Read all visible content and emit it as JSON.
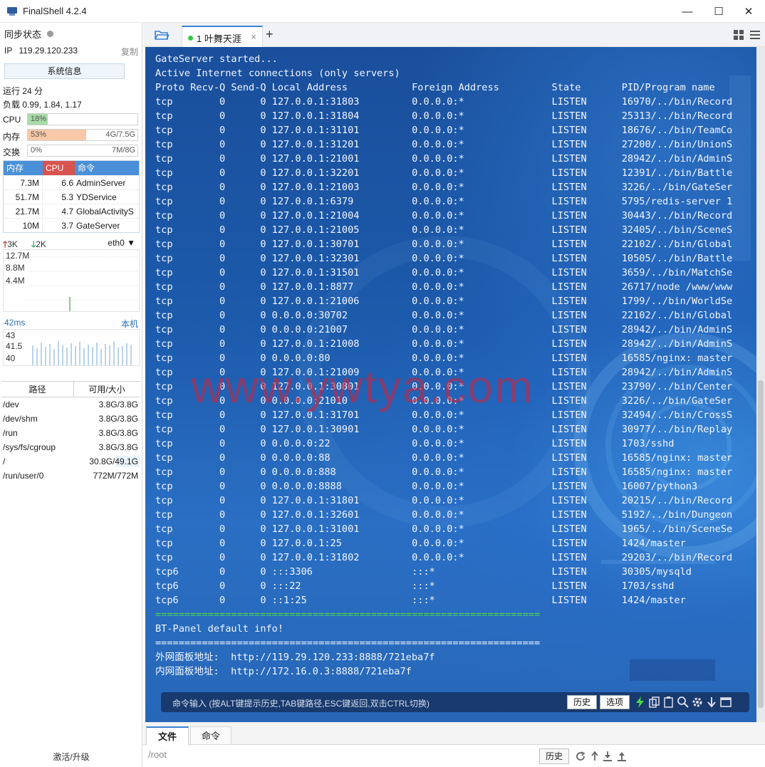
{
  "window": {
    "title": "FinalShell 4.2.4",
    "min": "—",
    "max": "☐",
    "close": "✕"
  },
  "sidebar": {
    "sync_label": "同步状态",
    "ip_label": "IP",
    "ip_value": "119.29.120.233",
    "copy_label": "复制",
    "sysinfo_button": "系统信息",
    "uptime": "运行 24 分",
    "load": "负载 0.99, 1.84, 1.17",
    "cpu": {
      "label": "CPU",
      "percent": "18%",
      "value": 0.18
    },
    "mem": {
      "label": "内存",
      "percent": "53%",
      "size": "4G/7.5G",
      "value": 0.53
    },
    "swap": {
      "label": "交换",
      "percent": "0%",
      "size": "7M/8G",
      "value": 0.0
    },
    "process_header": {
      "mem": "内存",
      "cpu": "CPU",
      "cmd": "命令"
    },
    "processes": [
      {
        "mem": "7.3M",
        "cpu": "6.6",
        "cmd": "AdminServer"
      },
      {
        "mem": "51.7M",
        "cpu": "5.3",
        "cmd": "YDService"
      },
      {
        "mem": "21.7M",
        "cpu": "4.7",
        "cmd": "GlobalActivityS"
      },
      {
        "mem": "10M",
        "cpu": "3.7",
        "cmd": "GateServer"
      }
    ],
    "net": {
      "up": "3K",
      "down": "2K",
      "interface": "eth0",
      "up_arrow": "🡑",
      "down_arrow": "🡓",
      "dropdown": "▼"
    },
    "net_scale": [
      "12.7M",
      "8.8M",
      "4.4M"
    ],
    "latency": {
      "ms": "42ms",
      "host": "本机"
    },
    "latency_scale": [
      "43",
      "41.5",
      "40"
    ],
    "disk_header": {
      "path": "路径",
      "size": "可用/大小"
    },
    "disks": [
      {
        "path": "/dev",
        "size": "3.8G/3.8G",
        "used": 0.0
      },
      {
        "path": "/dev/shm",
        "size": "3.8G/3.8G",
        "used": 0.0
      },
      {
        "path": "/run",
        "size": "3.8G/3.8G",
        "used": 0.0
      },
      {
        "path": "/sys/fs/cgroup",
        "size": "3.8G/3.8G",
        "used": 0.0
      },
      {
        "path": "/",
        "size": "30.8G/49.1G",
        "used": 0.37
      },
      {
        "path": "/run/user/0",
        "size": "772M/772M",
        "used": 0.0
      }
    ],
    "activate": "激活/升级"
  },
  "tabs": {
    "items": [
      {
        "label": "1 叶舞天涯",
        "close": "×"
      }
    ],
    "add": "+"
  },
  "terminal": {
    "lines": [
      "GateServer started...",
      "Active Internet connections (only servers)",
      "Proto Recv-Q Send-Q Local Address           Foreign Address         State       PID/Program name",
      "tcp        0      0 127.0.0.1:31803         0.0.0.0:*               LISTEN      16970/../bin/Record",
      "tcp        0      0 127.0.0.1:31804         0.0.0.0:*               LISTEN      25313/../bin/Record",
      "tcp        0      0 127.0.0.1:31101         0.0.0.0:*               LISTEN      18676/../bin/TeamCo",
      "tcp        0      0 127.0.0.1:31201         0.0.0.0:*               LISTEN      27200/../bin/UnionS",
      "tcp        0      0 127.0.0.1:21001         0.0.0.0:*               LISTEN      28942/../bin/AdminS",
      "tcp        0      0 127.0.0.1:32201         0.0.0.0:*               LISTEN      12391/../bin/Battle",
      "tcp        0      0 127.0.0.1:21003         0.0.0.0:*               LISTEN      3226/../bin/GateSer",
      "tcp        0      0 127.0.0.1:6379          0.0.0.0:*               LISTEN      5795/redis-server 1",
      "tcp        0      0 127.0.0.1:21004         0.0.0.0:*               LISTEN      30443/../bin/Record",
      "tcp        0      0 127.0.0.1:21005         0.0.0.0:*               LISTEN      32405/../bin/SceneS",
      "tcp        0      0 127.0.0.1:30701         0.0.0.0:*               LISTEN      22102/../bin/Global",
      "tcp        0      0 127.0.0.1:32301         0.0.0.0:*               LISTEN      10505/../bin/Battle",
      "tcp        0      0 127.0.0.1:31501         0.0.0.0:*               LISTEN      3659/../bin/MatchSe",
      "tcp        0      0 127.0.0.1:8877          0.0.0.0:*               LISTEN      26717/node /www/www",
      "tcp        0      0 127.0.0.1:21006         0.0.0.0:*               LISTEN      1799/../bin/WorldSe",
      "tcp        0      0 0.0.0.0:30702           0.0.0.0:*               LISTEN      22102/../bin/Global",
      "tcp        0      0 0.0.0.0:21007           0.0.0.0:*               LISTEN      28942/../bin/AdminS",
      "tcp        0      0 127.0.0.1:21008         0.0.0.0:*               LISTEN      28942/../bin/AdminS",
      "tcp        0      0 0.0.0.0:80              0.0.0.0:*               LISTEN      16585/nginx: master",
      "tcp        0      0 127.0.0.1:21009         0.0.0.0:*               LISTEN      28942/../bin/AdminS",
      "tcp        0      0 127.0.0.1:30801         0.0.0.0:*               LISTEN      23790/../bin/Center",
      "tcp        0      0 0.0.0.0:21010           0.0.0.0:*               LISTEN      3226/../bin/GateSer",
      "tcp        0      0 127.0.0.1:31701         0.0.0.0:*               LISTEN      32494/../bin/CrossS",
      "tcp        0      0 127.0.0.1:30901         0.0.0.0:*               LISTEN      30977/../bin/Replay",
      "tcp        0      0 0.0.0.0:22              0.0.0.0:*               LISTEN      1703/sshd",
      "tcp        0      0 0.0.0.0:88              0.0.0.0:*               LISTEN      16585/nginx: master",
      "tcp        0      0 0.0.0.0:888             0.0.0.0:*               LISTEN      16585/nginx: master",
      "tcp        0      0 0.0.0.0:8888            0.0.0.0:*               LISTEN      16007/python3",
      "tcp        0      0 127.0.0.1:31801         0.0.0.0:*               LISTEN      20215/../bin/Record",
      "tcp        0      0 127.0.0.1:32601         0.0.0.0:*               LISTEN      5192/../bin/Dungeon",
      "tcp        0      0 127.0.0.1:31001         0.0.0.0:*               LISTEN      1965/../bin/SceneSe",
      "tcp        0      0 127.0.0.1:25            0.0.0.0:*               LISTEN      1424/master",
      "tcp        0      0 127.0.0.1:31802         0.0.0.0:*               LISTEN      29203/../bin/Record",
      "tcp6       0      0 :::3306                 :::*                    LISTEN      30305/mysqld",
      "tcp6       0      0 :::22                   :::*                    LISTEN      1703/sshd",
      "tcp6       0      0 ::1:25                  :::*                    LISTEN      1424/master",
      "==================================================================",
      "BT-Panel default info!",
      "==================================================================",
      "外网面板地址:  http://119.29.120.233:8888/721eba7f",
      "内网面板地址:  http://172.16.0.3:8888/721eba7f"
    ],
    "green_line_index": 39,
    "watermark": "www.ywtya.com"
  },
  "command": {
    "placeholder": "命令输入 (按ALT键提示历史,TAB键路径,ESC键返回,双击CTRL切换)",
    "history": "历史",
    "options": "选项"
  },
  "bottom": {
    "tabs": [
      "文件",
      "命令"
    ],
    "path": "/root",
    "history": "历史"
  },
  "colors": {
    "accent": "#3b82d6",
    "terminal_bg": "#1c5aab",
    "green": "#4cd94c",
    "mem_fill": "#f7c9a8",
    "cpu_fill": "#a8dca8"
  }
}
